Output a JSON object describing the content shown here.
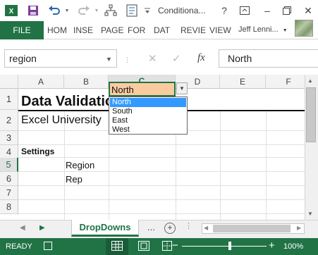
{
  "titlebar": {
    "document_title": "Conditiona...",
    "help_label": "?",
    "minimize_label": "–",
    "close_label": "✕"
  },
  "ribbon": {
    "file_tab": "FILE",
    "tabs": [
      "HOM",
      "INSE",
      "PAGE",
      "FOR",
      "DAT",
      "REVIE",
      "VIEW"
    ],
    "user_name": "Jeff Lenni..."
  },
  "formula_bar": {
    "name_box": "region",
    "formula_value": "North"
  },
  "grid": {
    "columns": [
      "A",
      "B",
      "C",
      "D",
      "E",
      "F"
    ],
    "rows": [
      "1",
      "2",
      "3",
      "4",
      "5",
      "6",
      "7",
      "8"
    ],
    "selected_column": "C",
    "selected_row": "5",
    "cells": {
      "title": "Data Validation",
      "subtitle": "Excel University",
      "settings": "Settings",
      "region_label": "Region",
      "rep_label": "Rep",
      "region_value": "North"
    }
  },
  "dropdown": {
    "options": [
      "North",
      "South",
      "East",
      "West"
    ],
    "highlighted": "North"
  },
  "sheet_tabs": {
    "active": "DropDowns",
    "more": "...",
    "add_label": "+"
  },
  "status_bar": {
    "status": "READY",
    "zoom": "100%"
  },
  "colors": {
    "excel_green": "#217346",
    "active_cell_fill": "#fbcba0",
    "dropdown_highlight": "#3399ff"
  }
}
